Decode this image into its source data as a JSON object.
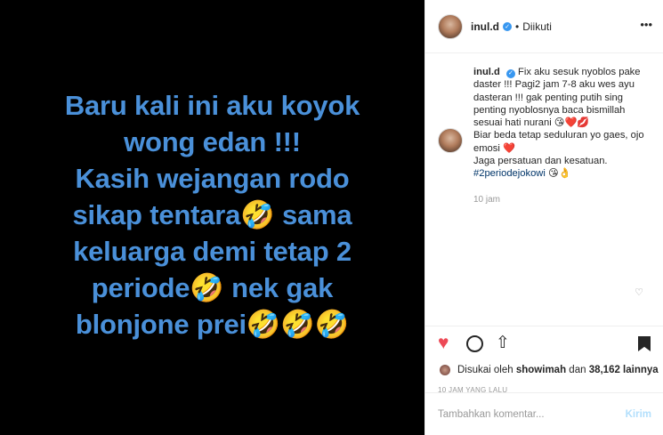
{
  "post_image": {
    "lines": [
      "Baru kali ini aku koyok",
      "wong edan !!!",
      "Kasih wejangan rodo",
      "sikap tentara🤣 sama",
      "keluarga demi tetap 2",
      "periode🤣 nek gak",
      "blonjone prei🤣🤣🤣"
    ],
    "text_color": "#4a90d9",
    "background": "#000000"
  },
  "header": {
    "username": "inul.d",
    "verified_icon": "verified-badge-icon",
    "separator": "•",
    "follow_status": "Diikuti",
    "more_icon": "•••"
  },
  "caption": {
    "username": "inul.d",
    "text1": "Fix aku sesuk nyoblos pake daster !!! Pagi2 jam 7-8 aku wes ayu dasteran !!! gak penting putih sing penting nyoblosnya baca bismillah sesuai hati nurani 😘❤️💋",
    "text2": "Biar beda tetap seduluran yo gaes, ojo emosi ❤️",
    "text3": "Jaga persatuan dan kesatuan.",
    "hashtag": "#2periodejokowi",
    "emojis": "😘👌",
    "time": "10 jam"
  },
  "actions": {
    "like_icon": "♥",
    "share_icon": "⇧"
  },
  "likes": {
    "prefix": "Disukai oleh ",
    "user": "showimah",
    "middle": " dan ",
    "count": "38,162 lainnya"
  },
  "date": "10 JAM YANG LALU",
  "comment_box": {
    "placeholder": "Tambahkan komentar...",
    "post_label": "Kirim"
  },
  "colors": {
    "accent": "#3897f0",
    "like": "#ed4956"
  }
}
